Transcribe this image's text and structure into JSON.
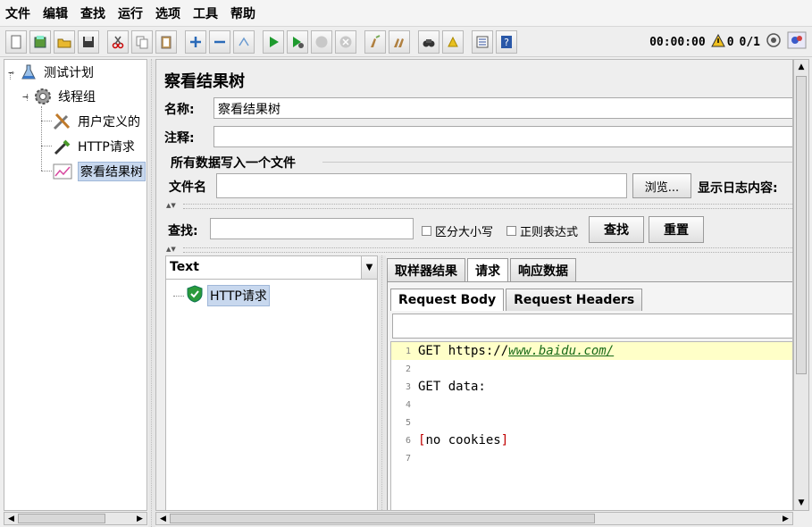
{
  "menu": [
    "文件",
    "编辑",
    "查找",
    "运行",
    "选项",
    "工具",
    "帮助"
  ],
  "toolbar": {
    "timer": "00:00:00",
    "warnings": "0",
    "threads": "0/1"
  },
  "tree": {
    "root": "测试计划",
    "thread_group": "线程组",
    "children": [
      "用户定义的",
      "HTTP请求",
      "察看结果树"
    ]
  },
  "panel": {
    "title": "察看结果树",
    "name_label": "名称:",
    "name_value": "察看结果树",
    "comment_label": "注释:",
    "file_group": "所有数据写入一个文件",
    "filename_label": "文件名",
    "browse": "浏览...",
    "log_label": "显示日志内容:",
    "search_label": "查找:",
    "case_label": "区分大小写",
    "regex_label": "正则表达式",
    "find_btn": "查找",
    "reset_btn": "重置"
  },
  "results": {
    "renderer": "Text",
    "sample": "HTTP请求"
  },
  "tabs": {
    "main": [
      "取样器结果",
      "请求",
      "响应数据"
    ],
    "active_main": 1,
    "sub": [
      "Request Body",
      "Request Headers"
    ],
    "active_sub": 0
  },
  "editor": {
    "line_numbers": [
      "1",
      "2",
      "3",
      "4",
      "5",
      "6",
      "7"
    ],
    "line1_prefix": "GET https://",
    "line1_link": "www.baidu.com/",
    "line3": "GET data:",
    "line6_open": "[",
    "line6_text": "no cookies",
    "line6_close": "]"
  },
  "colors": {
    "selection": "#c8d8ee",
    "highlight_line": "#ffffc8",
    "link": "#1a6b1a"
  }
}
